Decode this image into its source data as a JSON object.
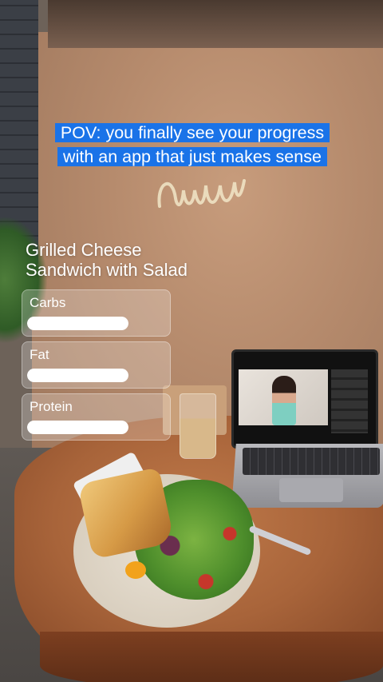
{
  "caption": {
    "line1": "POV: you finally see your progress",
    "line2": "with an app that just makes sense",
    "accent": "#1a73e8"
  },
  "meal": {
    "title_line1": "Grilled Cheese",
    "title_line2": "Sandwich with Salad"
  },
  "macros": [
    {
      "label": "Carbs",
      "progress": 1.0
    },
    {
      "label": "Fat",
      "progress": 1.0
    },
    {
      "label": "Protein",
      "progress": 1.0
    }
  ]
}
